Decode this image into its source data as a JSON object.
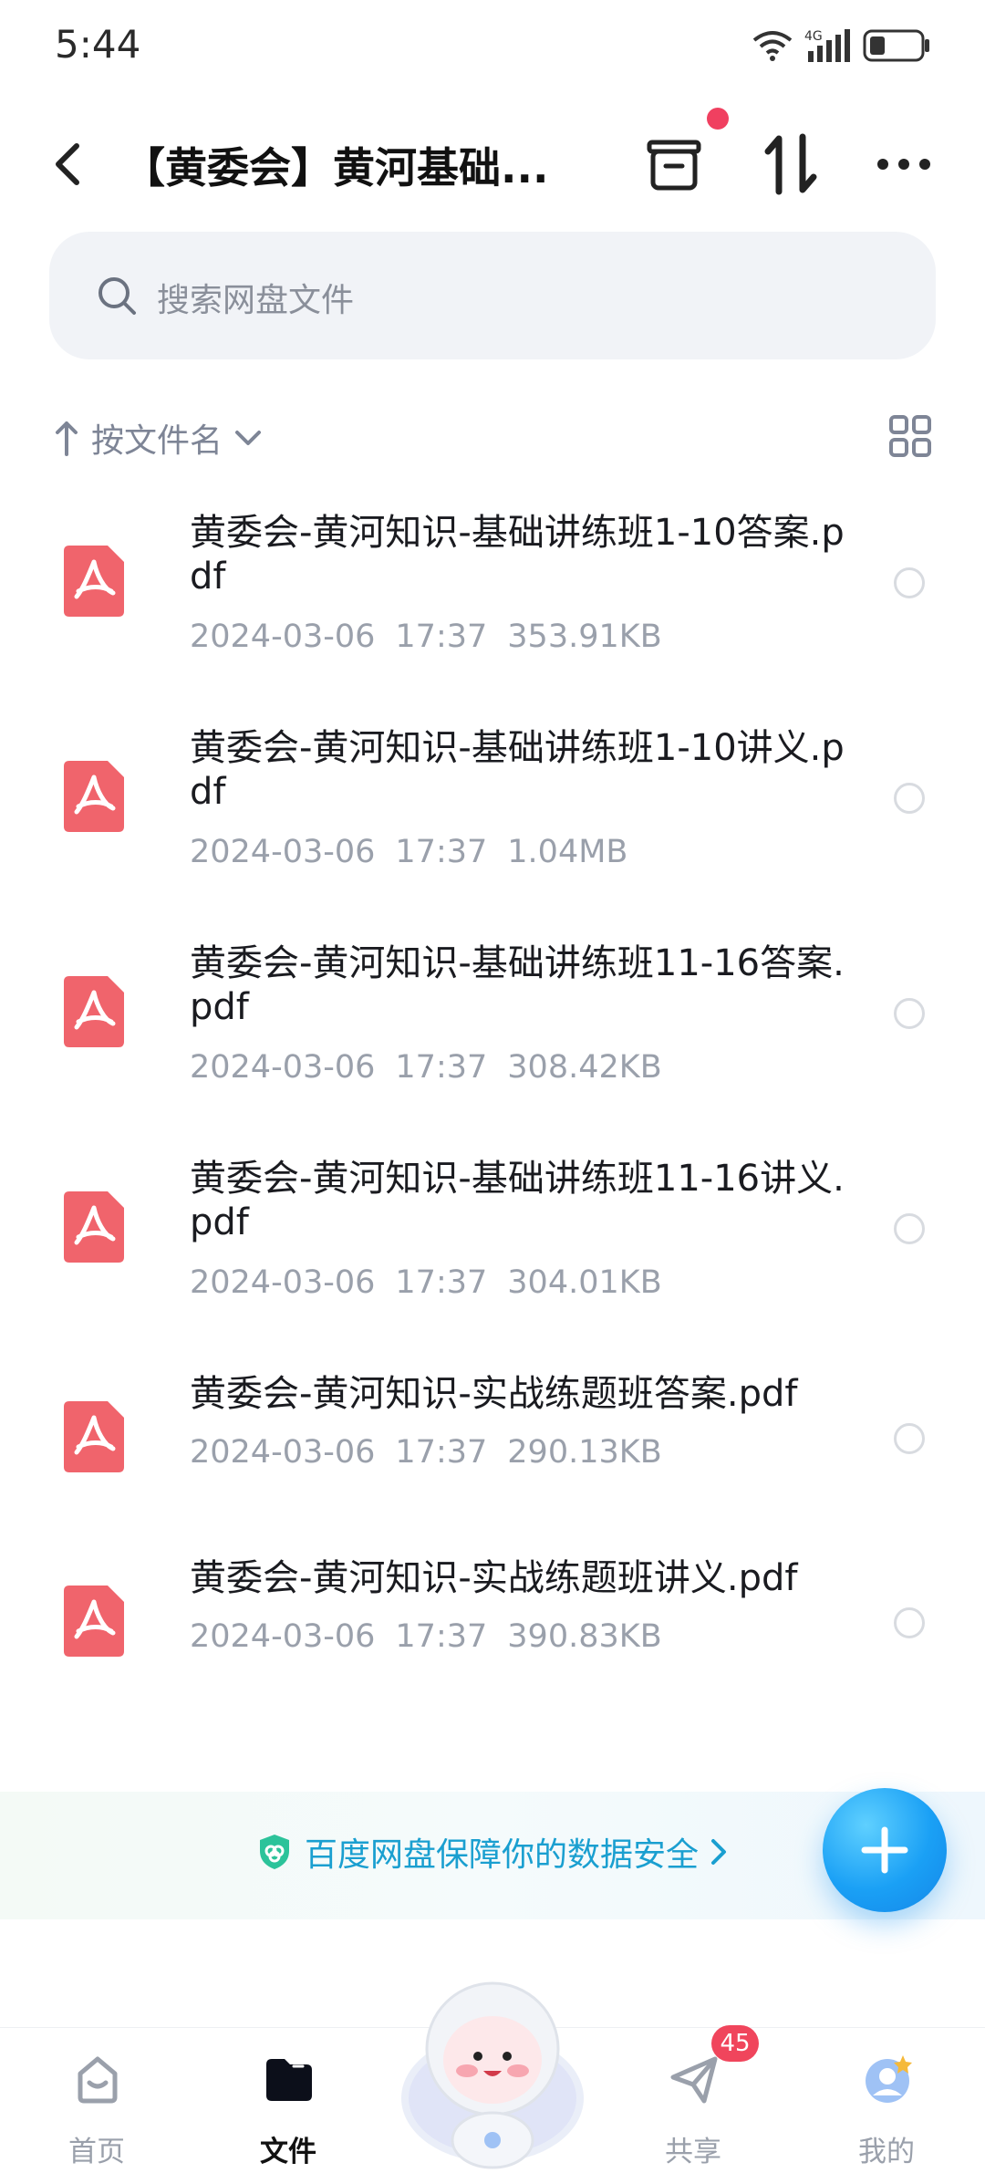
{
  "status_bar": {
    "time": "5:44",
    "network": "4G"
  },
  "header": {
    "title": "【黄委会】黄河基础..."
  },
  "search": {
    "placeholder": "搜索网盘文件"
  },
  "sort": {
    "label": "按文件名"
  },
  "files": [
    {
      "name": "黄委会-黄河知识-基础讲练班1-10答案.pdf",
      "date": "2024-03-06",
      "time": "17:37",
      "size": "353.91KB"
    },
    {
      "name": "黄委会-黄河知识-基础讲练班1-10讲义.pdf",
      "date": "2024-03-06",
      "time": "17:37",
      "size": "1.04MB"
    },
    {
      "name": "黄委会-黄河知识-基础讲练班11-16答案.pdf",
      "date": "2024-03-06",
      "time": "17:37",
      "size": "308.42KB"
    },
    {
      "name": "黄委会-黄河知识-基础讲练班11-16讲义.pdf",
      "date": "2024-03-06",
      "time": "17:37",
      "size": "304.01KB"
    },
    {
      "name": "黄委会-黄河知识-实战练题班答案.pdf",
      "date": "2024-03-06",
      "time": "17:37",
      "size": "290.13KB"
    },
    {
      "name": "黄委会-黄河知识-实战练题班讲义.pdf",
      "date": "2024-03-06",
      "time": "17:37",
      "size": "390.83KB"
    }
  ],
  "safety_banner": {
    "text": "百度网盘保障你的数据安全"
  },
  "bottom_nav": {
    "items": [
      {
        "label": "首页",
        "icon": "home-icon"
      },
      {
        "label": "文件",
        "icon": "folder-icon"
      },
      {
        "label": "共享",
        "icon": "share-icon"
      },
      {
        "label": "我的",
        "icon": "profile-icon"
      }
    ],
    "share_badge": "45"
  },
  "colors": {
    "accent": "#1aa0f5",
    "pdf": "#f0646c",
    "badge": "#f0455c"
  }
}
